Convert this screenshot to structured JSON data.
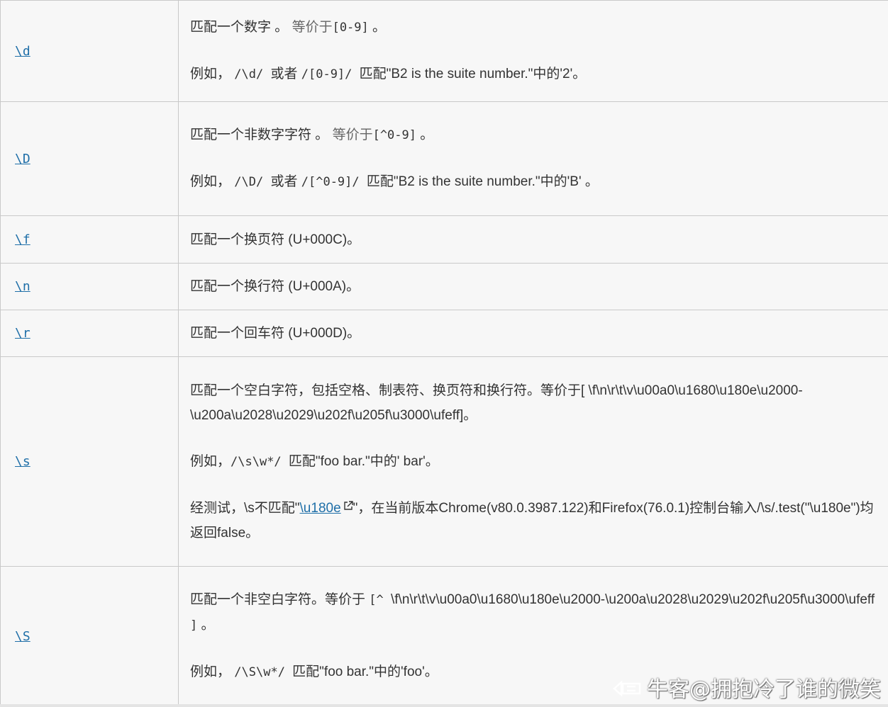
{
  "rows": [
    {
      "key": "\\d",
      "desc": [
        {
          "segments": [
            {
              "t": "匹配一个数字 。 "
            },
            {
              "t": "等价于",
              "cls": "muted"
            },
            {
              "t": "[0-9]",
              "code": true
            },
            {
              "t": " 。"
            }
          ]
        },
        {
          "segments": [
            {
              "t": "例如， "
            },
            {
              "t": " /\\d/ ",
              "code": true
            },
            {
              "t": "或者 "
            },
            {
              "t": "/[0-9]/ ",
              "code": true
            },
            {
              "t": "匹配\"B2 is the suite number.\"中的'2'。"
            }
          ]
        }
      ]
    },
    {
      "key": "\\D",
      "desc": [
        {
          "segments": [
            {
              "t": "匹配一个非数字字符 。 "
            },
            {
              "t": "等价于",
              "cls": "muted"
            },
            {
              "t": "[^0-9]",
              "code": true
            },
            {
              "t": " 。"
            }
          ]
        },
        {
          "segments": [
            {
              "t": "例如， "
            },
            {
              "t": " /\\D/ ",
              "code": true
            },
            {
              "t": "或者 "
            },
            {
              "t": "/[^0-9]/ ",
              "code": true
            },
            {
              "t": "匹配\"B2 is the suite number.\"中的'B' 。"
            }
          ]
        }
      ]
    },
    {
      "key": "\\f",
      "desc": [
        {
          "segments": [
            {
              "t": "匹配一个换页符 (U+000C)。"
            }
          ]
        }
      ]
    },
    {
      "key": "\\n",
      "desc": [
        {
          "segments": [
            {
              "t": "匹配一个换行符 (U+000A)。"
            }
          ]
        }
      ]
    },
    {
      "key": "\\r",
      "desc": [
        {
          "segments": [
            {
              "t": "匹配一个回车符 (U+000D)。"
            }
          ]
        }
      ]
    },
    {
      "key": "\\s",
      "desc": [
        {
          "segments": [
            {
              "t": "匹配一个空白字符，包括空格、制表符、换页符和换行符。等价于[ \\f\\n\\r\\t\\v\\u00a0\\u1680\\u180e\\u2000-\\u200a\\u2028\\u2029\\u202f\\u205f\\u3000\\ufeff]。"
            }
          ]
        },
        {
          "segments": [
            {
              "t": "例如，",
              "code": false
            },
            {
              "t": "/\\s\\w*/ ",
              "code": true
            },
            {
              "t": "匹配\"foo bar.\"中的' bar'。"
            }
          ]
        },
        {
          "segments": [
            {
              "t": "经测试，\\s不匹配\""
            },
            {
              "t": "\\u180e",
              "link": true
            },
            {
              "t": "\"，在当前版本Chrome(v80.0.3987.122)和Firefox(76.0.1)控制台输入/\\s/.test(\"\\u180e\")均返回false。"
            }
          ]
        }
      ]
    },
    {
      "key": "\\S",
      "desc": [
        {
          "segments": [
            {
              "t": "匹配一个非空白字符。等价于 "
            },
            {
              "t": "[^ ",
              "code": true
            },
            {
              "t": " \\f\\n\\r\\t\\v\\u00a0\\u1680\\u180e\\u2000-\\u200a\\u2028\\u2029\\u202f\\u205f\\u3000\\ufeff "
            },
            {
              "t": "]",
              "code": true
            },
            {
              "t": " 。"
            }
          ]
        },
        {
          "segments": [
            {
              "t": "例如， "
            },
            {
              "t": "/\\S\\w*/ ",
              "code": true
            },
            {
              "t": "匹配\"foo bar.\"中的'foo'。"
            }
          ]
        }
      ]
    }
  ],
  "row_heights_px": [],
  "watermark": {
    "text": "牛客@拥抱冷了谁的微笑",
    "icon": "nowcoder-logo-icon"
  },
  "colors": {
    "link": "#1f6fa8",
    "border": "#c9c9c9",
    "background": "#f7f7f7",
    "text": "#333333"
  }
}
